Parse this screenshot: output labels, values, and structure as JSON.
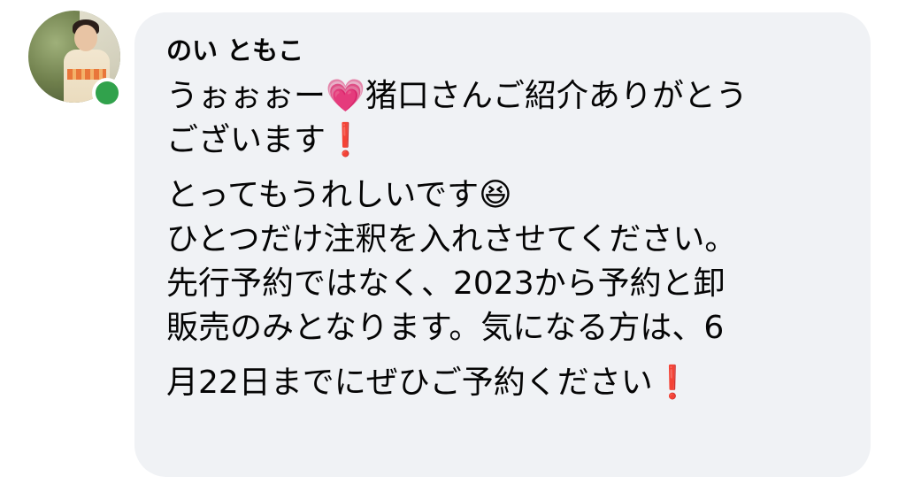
{
  "author": {
    "name": "のい ともこ",
    "online": true,
    "status_color": "#31a24c"
  },
  "bubble": {
    "background": "#f0f2f5"
  },
  "message": {
    "lines": [
      "うぉぉぉー💗猪口さんご紹介ありがとう",
      "ございます❗️",
      "とってもうれしいです😆",
      "ひとつだけ注釈を入れさせてください。",
      "先行予約ではなく、2023から予約と卸",
      "販売のみとなります。気になる方は、6",
      "月22日までにぜひご予約ください❗️"
    ]
  },
  "icons": {
    "avatar": "profile-photo",
    "online": "online-status-dot"
  }
}
